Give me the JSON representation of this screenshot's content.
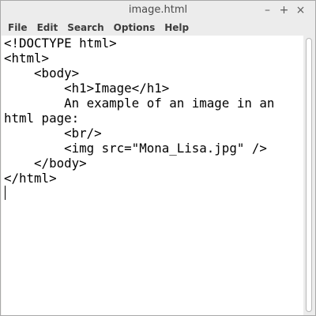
{
  "window": {
    "title": "image.html",
    "controls": {
      "minimize": "–",
      "maximize": "+",
      "close": "×"
    }
  },
  "menubar": {
    "items": [
      "File",
      "Edit",
      "Search",
      "Options",
      "Help"
    ]
  },
  "editor": {
    "lines": [
      "<!DOCTYPE html>",
      "<html>",
      "    <body>",
      "        <h1>Image</h1>",
      "        An example of an image in an",
      "html page:",
      "        <br/>",
      "        <img src=\"Mona_Lisa.jpg\" />",
      "    </body>",
      "</html>"
    ]
  },
  "colors": {
    "window_background": "#f2f1f0",
    "editor_background": "#ffffff",
    "text": "#000000"
  }
}
